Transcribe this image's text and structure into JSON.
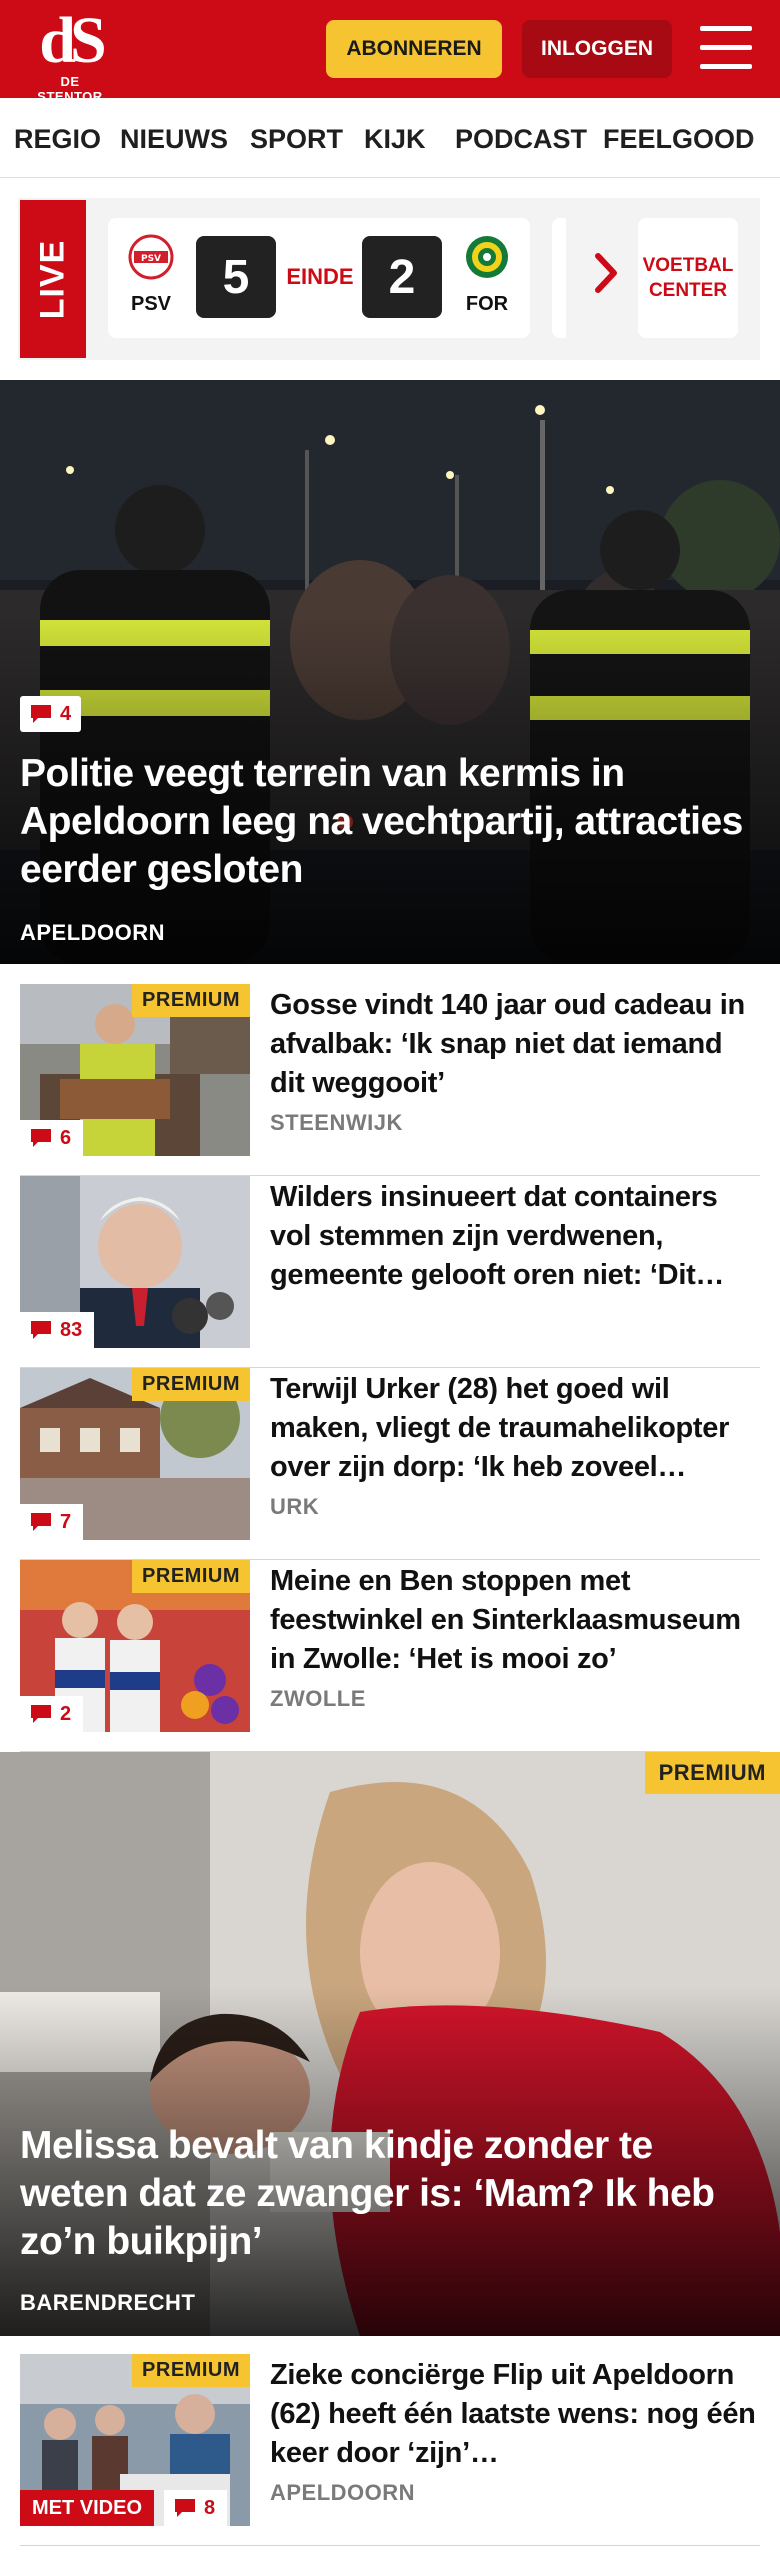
{
  "header": {
    "logo_mark": "dS",
    "logo_sub": "DE STENTOR",
    "subscribe_label": "ABONNEREN",
    "login_label": "INLOGGEN",
    "brand_color": "#cc0b16"
  },
  "nav": {
    "items": [
      "REGIO",
      "NIEUWS",
      "SPORT",
      "KIJK",
      "PODCAST",
      "FEELGOOD"
    ]
  },
  "live": {
    "label": "LIVE",
    "home_team": "PSV",
    "home_score": "5",
    "status": "EINDE",
    "away_score": "2",
    "away_team": "FOR",
    "center_label": "VOETBAL CENTER"
  },
  "hero": {
    "comments": "4",
    "title": "Politie veegt terrein van kermis in Apeldoorn leeg na vechtpartij, attracties eerder gesloten",
    "location": "APELDOORN"
  },
  "articles": [
    {
      "premium": "PREMIUM",
      "comments": "6",
      "title": "Gosse vindt 140 jaar oud cadeau in afvalbak: ‘Ik snap niet dat iemand dit weggooit’",
      "location": "STEENWIJK"
    },
    {
      "comments": "83",
      "title": "Wilders insinueert dat containers vol stemmen zijn verdwenen, gemeente gelooft oren niet: ‘Dit…",
      "location": ""
    },
    {
      "premium": "PREMIUM",
      "comments": "7",
      "title": "Terwijl Urker (28) het goed wil maken, vliegt de traumahelikop­ter over zijn dorp: ‘Ik heb zoveel…",
      "location": "URK"
    },
    {
      "premium": "PREMIUM",
      "comments": "2",
      "title": "Meine en Ben stoppen met feestwinkel en Sinterklaasmuse­um in Zwolle: ‘Het is mooi zo’",
      "location": "ZWOLLE"
    }
  ],
  "hero2": {
    "premium": "PREMIUM",
    "title": "Melissa bevalt van kindje zonder te weten dat ze zwanger is: ‘Mam? Ik heb zo’n buikpijn’",
    "location": "BARENDRECHT"
  },
  "article5": {
    "premium": "PREMIUM",
    "video": "MET VIDEO",
    "comments": "8",
    "title": "Zieke conciërge Flip uit Apeldoorn (62) heeft één laatste wens: nog één keer door ‘zijn’…",
    "location": "APELDOORN"
  }
}
